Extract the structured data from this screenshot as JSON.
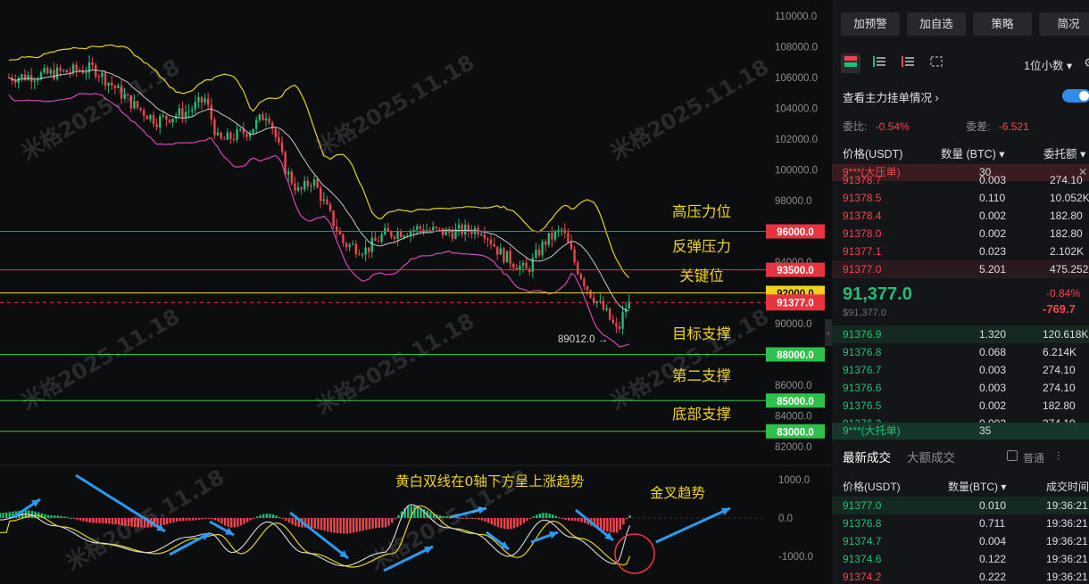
{
  "chart": {
    "price_labels": [
      "110000.0",
      "108000.0",
      "106000.0",
      "104000.0",
      "102000.0",
      "100000.0",
      "98000.0",
      "96000.0",
      "94000.0",
      "92000.0",
      "90000.0",
      "88000.0",
      "86000.0",
      "84000.0",
      "82000.0"
    ],
    "ind_labels": [
      "1000.0",
      "0.0",
      "-1000.0"
    ],
    "levels": [
      {
        "name": "高压力位",
        "price": "96000.0",
        "color": "#e8343f"
      },
      {
        "name": "反弹压力",
        "price": "93500.0",
        "color": "#e8343f"
      },
      {
        "name": "关键位",
        "price": "92000.0",
        "color": "#f0d21c"
      },
      {
        "name": "目标支撑",
        "price": "88000.0",
        "color": "#2fc24a"
      },
      {
        "name": "第二支撑",
        "price": "85000.0",
        "color": "#2fc24a"
      },
      {
        "name": "底部支撑",
        "price": "83000.0",
        "color": "#2fc24a"
      }
    ],
    "current_price": "91377.0",
    "low_marker": "89012.0 →",
    "annotation_trend": "黄白双线在0轴下方呈上涨趋势",
    "annotation_cross": "金叉趋势",
    "watermark": "米格2025.11.18"
  },
  "panel": {
    "buttons": [
      "加预警",
      "加自选",
      "策略",
      "简况"
    ],
    "decimals": "1位小数 ▾",
    "main_orders_label": "查看主力挂单情况",
    "ratio_label": "委比:",
    "ratio_value": "-0.54%",
    "diff_label": "委差:",
    "diff_value": "-6.521",
    "ob_cols": [
      "价格(USDT)",
      "数量 (BTC) ▾",
      "委托额 ▾"
    ],
    "sell_whale": {
      "name": "9***(大压单)",
      "qty": "30"
    },
    "buy_whale": {
      "name": "9***(大托单)",
      "qty": "35"
    },
    "asks": [
      [
        "91378.7",
        "0.003",
        "274.10"
      ],
      [
        "91378.5",
        "0.110",
        "10.052K"
      ],
      [
        "91378.4",
        "0.002",
        "182.80"
      ],
      [
        "91378.0",
        "0.002",
        "182.80"
      ],
      [
        "91377.1",
        "0.023",
        "2.102K"
      ],
      [
        "91377.0",
        "5.201",
        "475.252K"
      ]
    ],
    "mid": {
      "price": "91,377.0",
      "sub": "$91,377.0",
      "pct": "-0.84%",
      "chg": "-769.7"
    },
    "bids": [
      [
        "91376.9",
        "1.320",
        "120.618K"
      ],
      [
        "91376.8",
        "0.068",
        "6.214K"
      ],
      [
        "91376.7",
        "0.003",
        "274.10"
      ],
      [
        "91376.6",
        "0.003",
        "274.10"
      ],
      [
        "91376.5",
        "0.002",
        "182.80"
      ],
      [
        "91376.2",
        "0.002",
        "274.10"
      ]
    ],
    "trade_tabs": [
      "最新成交",
      "大额成交"
    ],
    "normal_label": "普通",
    "trade_cols": [
      "价格(USDT)",
      "数量(BTC) ▾",
      "成交时间"
    ],
    "trades": [
      [
        "91377.0",
        "0.010",
        "19:36:21"
      ],
      [
        "91376.8",
        "0.711",
        "19:36:21"
      ],
      [
        "91374.7",
        "0.004",
        "19:36:21"
      ],
      [
        "91374.6",
        "0.122",
        "19:36:21"
      ],
      [
        "91374.2",
        "0.222",
        "19:36:21"
      ]
    ]
  },
  "colors": {
    "up": "#1fbf75",
    "down": "#f0464b",
    "accent": "#2f8ce8"
  }
}
